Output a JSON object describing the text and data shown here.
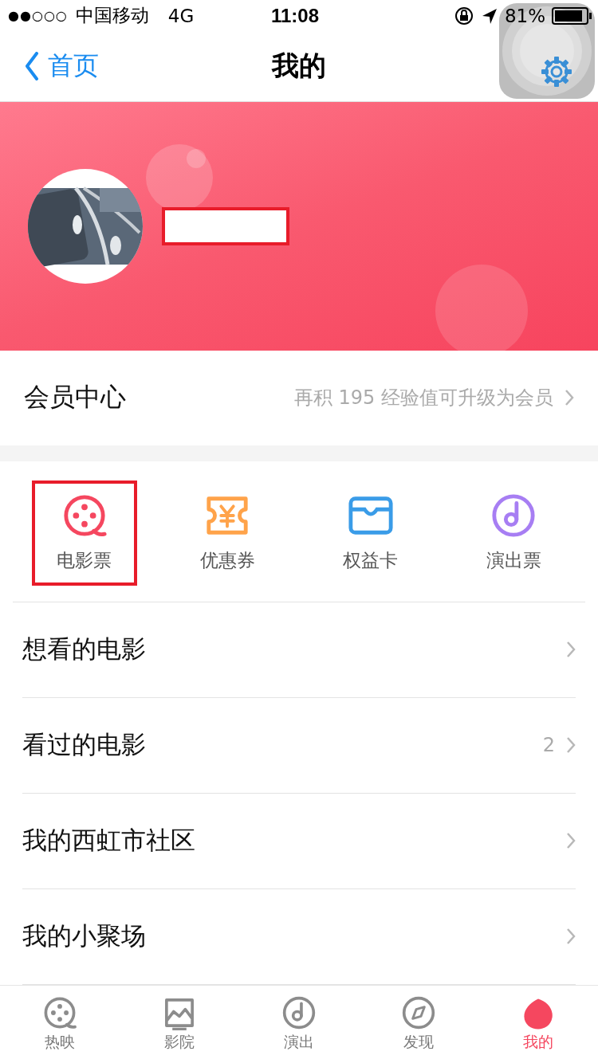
{
  "status_bar": {
    "signal_dots": "●●○○○",
    "carrier": "中国移动",
    "network": "4G",
    "time": "11:08",
    "battery_text": "81%"
  },
  "nav": {
    "back_label": "首页",
    "title": "我的"
  },
  "profile": {
    "name_redacted": true
  },
  "member": {
    "label": "会员中心",
    "hint": "再积 195 经验值可升级为会员"
  },
  "quick_items": [
    {
      "kind": "film",
      "label": "电影票",
      "color": "#f5475f",
      "highlighted": true
    },
    {
      "kind": "coupon",
      "label": "优惠券",
      "color": "#ffa34a",
      "highlighted": false
    },
    {
      "kind": "card",
      "label": "权益卡",
      "color": "#3a9ce8",
      "highlighted": false
    },
    {
      "kind": "music",
      "label": "演出票",
      "color": "#a77ef3",
      "highlighted": false
    }
  ],
  "menu": [
    {
      "label": "想看的电影"
    },
    {
      "label": "看过的电影",
      "count": "2"
    },
    {
      "label": "我的西虹市社区"
    },
    {
      "label": "我的小聚场"
    }
  ],
  "tabs": [
    {
      "kind": "film",
      "label": "热映",
      "selected": false
    },
    {
      "kind": "cinema",
      "label": "影院",
      "selected": false
    },
    {
      "kind": "music",
      "label": "演出",
      "selected": false
    },
    {
      "kind": "compass",
      "label": "发现",
      "selected": false
    },
    {
      "kind": "me",
      "label": "我的",
      "selected": true
    }
  ]
}
